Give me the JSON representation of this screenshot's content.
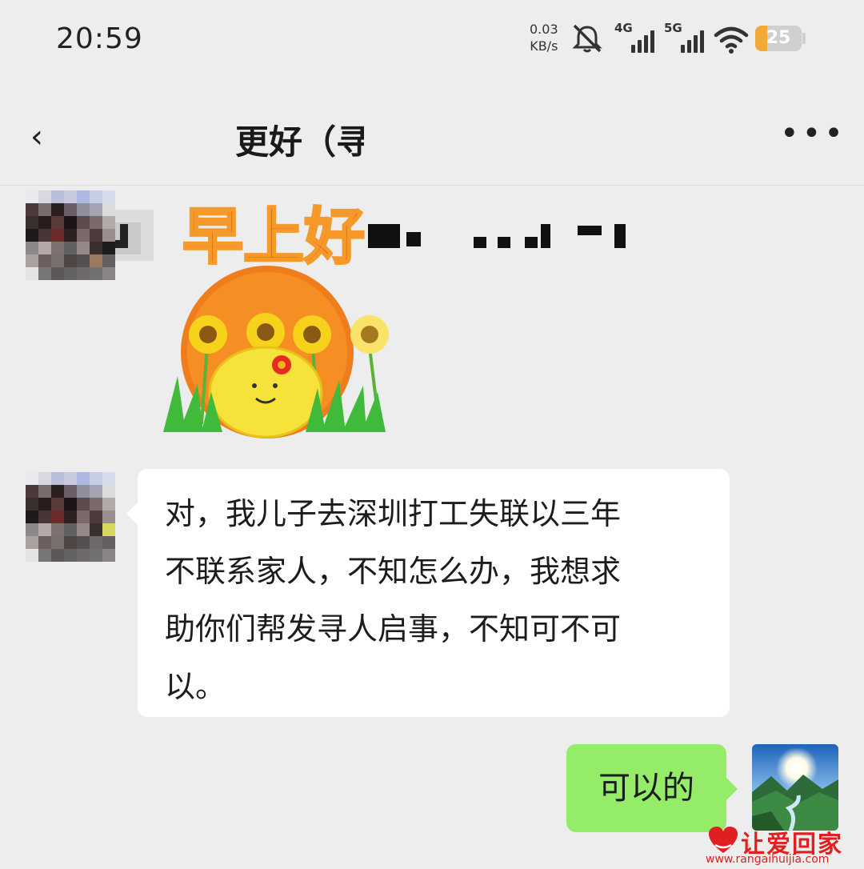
{
  "status_bar": {
    "time": "20:59",
    "net_speed_value": "0.03",
    "net_speed_unit": "KB/s",
    "signal_1_label": "4G",
    "signal_2_label": "5G",
    "battery_level": "25",
    "battery_fraction": 0.25
  },
  "header": {
    "back_icon": "chevron-left-icon",
    "title": "更好（寻",
    "more_icon": "more-dots-icon"
  },
  "messages": [
    {
      "sender": "contact",
      "type": "sticker",
      "sticker_text": "早上好"
    },
    {
      "sender": "contact",
      "type": "text",
      "lines": [
        "对，我儿子去深圳打工失联以三年",
        "不联系家人，不知怎么办，我想求",
        "助你们帮发寻人启事，不知可不可",
        "以。"
      ]
    },
    {
      "sender": "me",
      "type": "text",
      "text": "可以的"
    }
  ],
  "watermark": {
    "brand": "让爱回家",
    "url": "www.rangaihuijia.com"
  },
  "colors": {
    "background": "#ededed",
    "incoming_bubble": "#ffffff",
    "outgoing_bubble": "#95ec69",
    "battery": "#f3a83a",
    "watermark": "#e02020"
  }
}
